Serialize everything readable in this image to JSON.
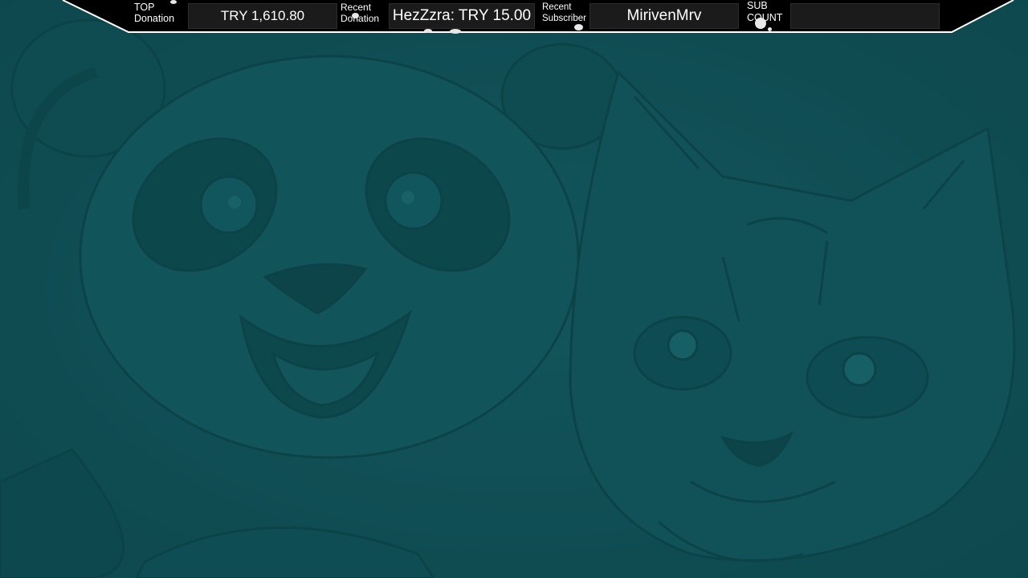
{
  "overlay": {
    "top_donation": {
      "label_line1": "TOP",
      "label_line2": "Donation",
      "value": "TRY 1,610.80"
    },
    "recent_donation": {
      "label_line1": "Recent",
      "label_line2": "Donation",
      "value": "HezZzra: TRY 15.00"
    },
    "recent_subscriber": {
      "label_line1": "Recent",
      "label_line2": "Subscriber",
      "value": "MirivenMrv"
    },
    "sub_count": {
      "label_line1": "SUB",
      "label_line2": "COUNT",
      "value": ""
    }
  },
  "colors": {
    "background_teal": "#0f4f55",
    "bar_black": "#000000",
    "box_dark": "#1b1b1b",
    "text_white": "#ffffff"
  },
  "icons": [
    "panda-illustration",
    "cat-illustration",
    "paint-speckle-decoration"
  ]
}
